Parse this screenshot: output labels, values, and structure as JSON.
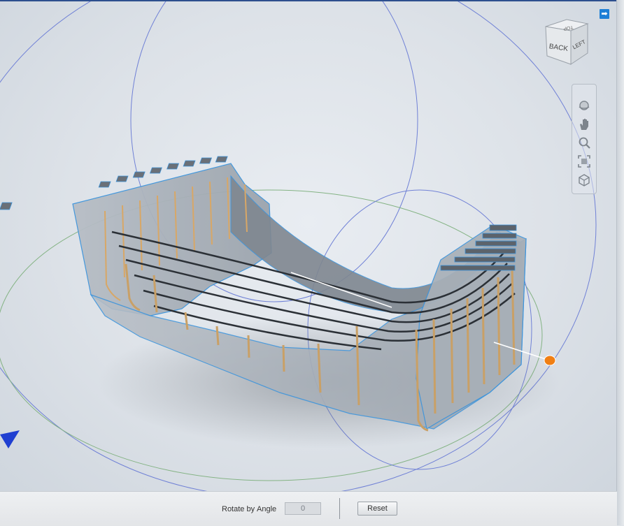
{
  "viewcube": {
    "faces": {
      "front": "BACK",
      "side": "LEFT",
      "top": "TOP"
    }
  },
  "icons": {
    "expand": "arrow-right-icon",
    "orbit": "orbit-icon",
    "pan": "hand-icon",
    "zoom": "magnifier-icon",
    "fit": "fit-to-window-icon",
    "look": "cube-icon",
    "manipulator": "gizmo-handle-icon"
  },
  "toolbar": {
    "rotate_label": "Rotate by",
    "angle_label": "Angle",
    "angle_value": "0",
    "reset_label": "Reset"
  },
  "colors": {
    "accent": "#1e7fd6",
    "manipulator_handle": "#f07f14",
    "orbit_ring_blue": "#6f80d8",
    "orbit_ring_green": "#7fb07f",
    "model_edges": "#3c94dc"
  }
}
